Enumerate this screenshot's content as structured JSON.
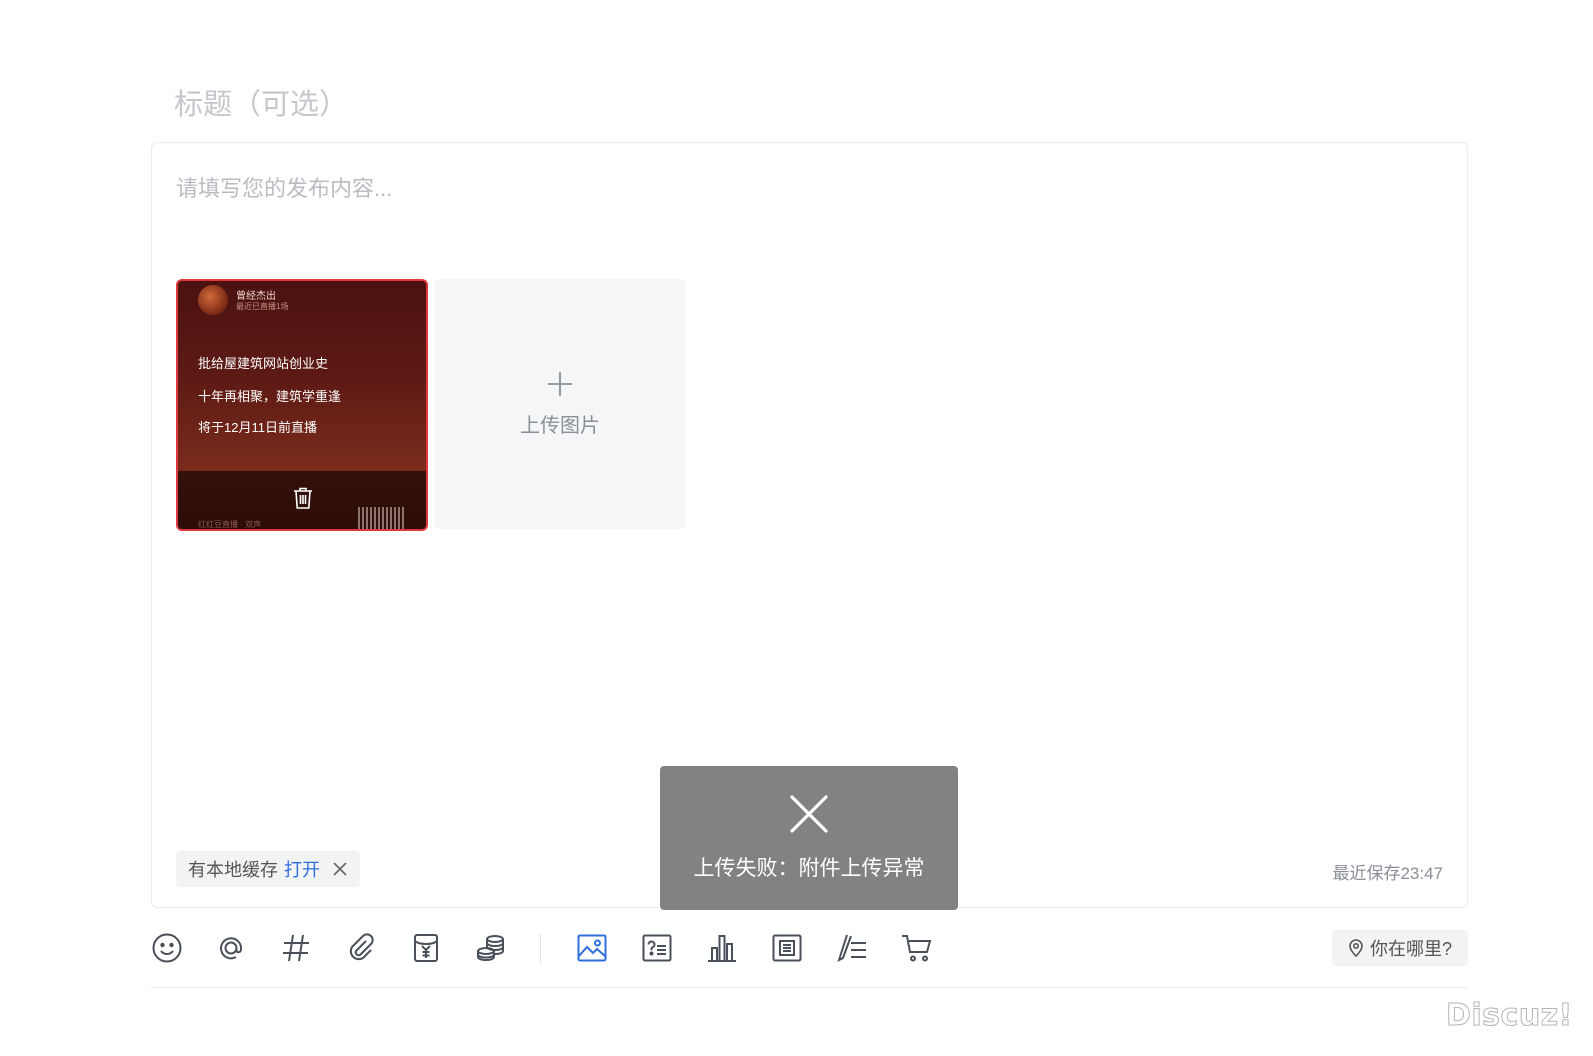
{
  "post": {
    "title_placeholder": "标题（可选）",
    "content_placeholder": "请填写您的发布内容..."
  },
  "attachment": {
    "author": "曾经杰出",
    "subtitle": "最近已直播1场",
    "lines": [
      "批给屋建筑网站创业史",
      "十年再相聚，建筑学重逢",
      "将于12月11日前直播"
    ],
    "footer": "红红豆直播 · 双声"
  },
  "upload": {
    "label": "上传图片"
  },
  "cache": {
    "text": "有本地缓存",
    "open_label": "打开"
  },
  "last_saved": "最近保存23:47",
  "toolbar": {
    "items": [
      "emoji-icon",
      "mention-icon",
      "hashtag-icon",
      "attachment-icon",
      "red-packet-icon",
      "reward-icon",
      "image-icon",
      "question-icon",
      "poll-icon",
      "article-icon",
      "long-text-icon",
      "cart-icon"
    ]
  },
  "location": {
    "label": "你在哪里?"
  },
  "toast": {
    "message": "上传失败：附件上传异常"
  },
  "watermark": "Discuz!",
  "colors": {
    "accent": "#2f6fdd",
    "error_border": "#e0373f",
    "icon": "#4a5059"
  }
}
